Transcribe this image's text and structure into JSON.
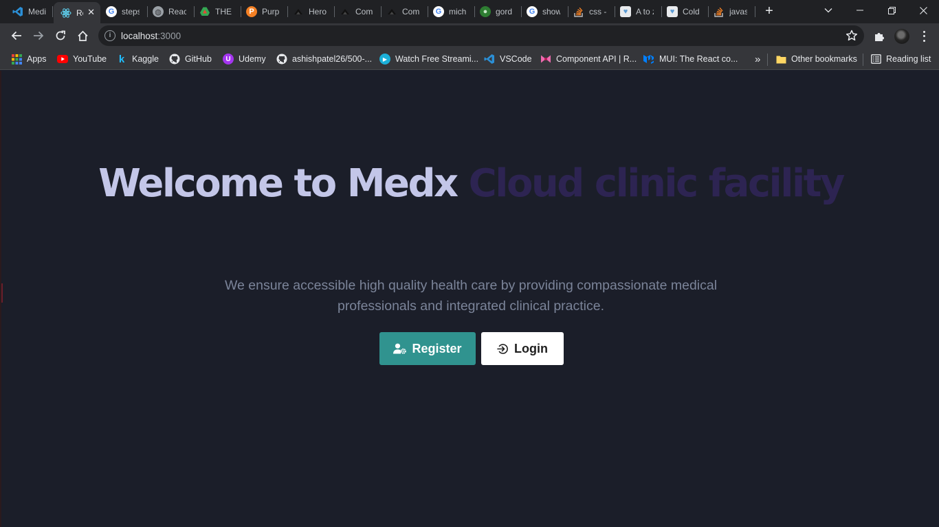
{
  "browser": {
    "tabs": [
      {
        "title": "Medi",
        "favicon": "vscode-icon",
        "color": "#2b8fd6"
      },
      {
        "title": "Re",
        "favicon": "react-icon",
        "color": "#61dafb",
        "active": true
      },
      {
        "title": "steps",
        "favicon": "google-icon",
        "color": "#ffffff"
      },
      {
        "title": "React",
        "favicon": "globe-icon",
        "color": "#9aa0a6"
      },
      {
        "title": "THE F",
        "favicon": "drive-icon",
        "color": "#34a853"
      },
      {
        "title": "Purpl",
        "favicon": "purple-app-icon",
        "color": "#f48024"
      },
      {
        "title": "Hero",
        "favicon": "tailwind-icon",
        "color": "#111111"
      },
      {
        "title": "Comp",
        "favicon": "tailwind-icon",
        "color": "#111111"
      },
      {
        "title": "Comp",
        "favicon": "tailwind-icon",
        "color": "#111111"
      },
      {
        "title": "mich",
        "favicon": "google-icon",
        "color": "#ffffff"
      },
      {
        "title": "gord",
        "favicon": "github-icon",
        "color": "#4caf50"
      },
      {
        "title": "show",
        "favicon": "google-icon",
        "color": "#ffffff"
      },
      {
        "title": "css -",
        "favicon": "stackoverflow-icon",
        "color": "#f48024"
      },
      {
        "title": "A to z",
        "favicon": "heart-icon",
        "color": "#5b9bd5"
      },
      {
        "title": "Cold",
        "favicon": "heart-icon",
        "color": "#5b9bd5"
      },
      {
        "title": "javas",
        "favicon": "stackoverflow-icon",
        "color": "#f48024"
      }
    ],
    "url_host": "localhost",
    "url_port": ":3000",
    "bookmarks": [
      {
        "label": "Apps",
        "icon": "apps-grid-icon",
        "color": "#ea4335"
      },
      {
        "label": "YouTube",
        "icon": "youtube-icon",
        "color": "#ff0000"
      },
      {
        "label": "Kaggle",
        "icon": "kaggle-icon",
        "color": "#20beff"
      },
      {
        "label": "GitHub",
        "icon": "github-icon",
        "color": "#e8eaed"
      },
      {
        "label": "Udemy",
        "icon": "udemy-icon",
        "color": "#a435f0"
      },
      {
        "label": "ashishpatel26/500-...",
        "icon": "github-icon",
        "color": "#e8eaed"
      },
      {
        "label": "Watch Free Streami...",
        "icon": "play-icon",
        "color": "#1cb0d8"
      },
      {
        "label": "VSCode",
        "icon": "vscode-icon",
        "color": "#2b8fd6"
      },
      {
        "label": "Component API | R...",
        "icon": "bow-icon",
        "color": "#ec6bae"
      },
      {
        "label": "MUI: The React co...",
        "icon": "mui-icon",
        "color": "#007fff"
      }
    ],
    "overflow": "»",
    "other_bookmarks": "Other bookmarks",
    "reading_list": "Reading list"
  },
  "hero": {
    "title_part1": "Welcome to Medx ",
    "title_part2": "Cloud clinic facility",
    "subtitle": "We ensure accessible high quality health care by providing compassionate medical professionals and integrated clinical practice.",
    "register_label": "Register",
    "login_label": "Login"
  },
  "colors": {
    "accent_teal": "#30938f",
    "title_light": "#c3c6e8",
    "title_dark": "#2d2452",
    "background": "#1b1e29"
  }
}
